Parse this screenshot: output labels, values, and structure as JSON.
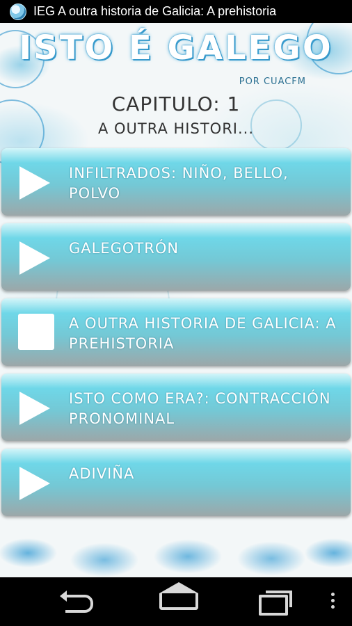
{
  "status_bar": {
    "title": "IEG A outra historia de Galicia: A prehistoria",
    "app_icon": "app-globe-icon"
  },
  "header": {
    "logo_title": "ISTO É GALEGO",
    "logo_subtitle": "POR CUACFM"
  },
  "chapter": {
    "title": "CAPITULO: 1",
    "subtitle": "A OUTRA HISTORI..."
  },
  "list": {
    "items": [
      {
        "label": "INFILTRADOS: NIÑO, BELLO, POLVO",
        "icon": "play-icon"
      },
      {
        "label": "GALEGOTRÓN",
        "icon": "play-icon"
      },
      {
        "label": "A OUTRA HISTORIA DE GALICIA: A PREHISTORIA",
        "icon": "stop-icon"
      },
      {
        "label": "ISTO COMO ERA?: CONTRACCIÓN PRONOMINAL",
        "icon": "play-icon"
      },
      {
        "label": "ADIVIÑA",
        "icon": "play-icon"
      }
    ]
  },
  "nav_bar": {
    "back": "back-icon",
    "home": "home-icon",
    "recents": "recent-apps-icon",
    "menu": "overflow-menu-icon"
  },
  "colors": {
    "accent": "#2a8fc4",
    "item_top": "#6fd7e8",
    "item_bottom": "#9ca7a9"
  }
}
